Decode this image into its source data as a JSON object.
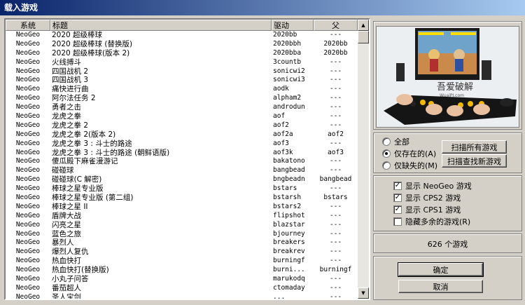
{
  "window": {
    "title": "载入游戏"
  },
  "columns": [
    "系统",
    "标题",
    "驱动",
    "父"
  ],
  "rows": [
    {
      "system": "NeoGeo",
      "title": "2020 超级棒球",
      "driver": "2020bb",
      "parent": "---"
    },
    {
      "system": "NeoGeo",
      "title": "2020 超级棒球 (替换版)",
      "driver": "2020bbh",
      "parent": "2020bb"
    },
    {
      "system": "NeoGeo",
      "title": "2020 超级棒球(版本 2)",
      "driver": "2020bba",
      "parent": "2020bb"
    },
    {
      "system": "NeoGeo",
      "title": "火线搏斗",
      "driver": "3countb",
      "parent": "---"
    },
    {
      "system": "NeoGeo",
      "title": "四国战机 2",
      "driver": "sonicwi2",
      "parent": "---"
    },
    {
      "system": "NeoGeo",
      "title": "四国战机 3",
      "driver": "sonicwi3",
      "parent": "---"
    },
    {
      "system": "NeoGeo",
      "title": "痛快进行曲",
      "driver": "aodk",
      "parent": "---"
    },
    {
      "system": "NeoGeo",
      "title": "阿尔法任务 2",
      "driver": "alpham2",
      "parent": "---"
    },
    {
      "system": "NeoGeo",
      "title": "勇者之击",
      "driver": "androdun",
      "parent": "---"
    },
    {
      "system": "NeoGeo",
      "title": "龙虎之拳",
      "driver": "aof",
      "parent": "---"
    },
    {
      "system": "NeoGeo",
      "title": "龙虎之拳 2",
      "driver": "aof2",
      "parent": "---"
    },
    {
      "system": "NeoGeo",
      "title": "龙虎之拳 2(版本 2)",
      "driver": "aof2a",
      "parent": "aof2"
    },
    {
      "system": "NeoGeo",
      "title": "龙虎之拳 3 : 斗士的路途",
      "driver": "aof3",
      "parent": "---"
    },
    {
      "system": "NeoGeo",
      "title": "龙虎之拳 3 : 斗士的路途 (朝鲜语版)",
      "driver": "aof3k",
      "parent": "aof3"
    },
    {
      "system": "NeoGeo",
      "title": "傻瓜殿下麻雀漫游记",
      "driver": "bakatono",
      "parent": "---"
    },
    {
      "system": "NeoGeo",
      "title": "碰碰球",
      "driver": "bangbead",
      "parent": "---"
    },
    {
      "system": "NeoGeo",
      "title": "碰碰球(C 解密)",
      "driver": "bngbeadn",
      "parent": "bangbead"
    },
    {
      "system": "NeoGeo",
      "title": "棒球之星专业版",
      "driver": "bstars",
      "parent": "---"
    },
    {
      "system": "NeoGeo",
      "title": "棒球之星专业版 (第二组)",
      "driver": "bstarsh",
      "parent": "bstars"
    },
    {
      "system": "NeoGeo",
      "title": "棒球之星 II",
      "driver": "bstars2",
      "parent": "---"
    },
    {
      "system": "NeoGeo",
      "title": "盾牌大战",
      "driver": "flipshot",
      "parent": "---"
    },
    {
      "system": "NeoGeo",
      "title": "闪亮之星",
      "driver": "blazstar",
      "parent": "---"
    },
    {
      "system": "NeoGeo",
      "title": "蓝色之旅",
      "driver": "bjourney",
      "parent": "---"
    },
    {
      "system": "NeoGeo",
      "title": "暴烈人",
      "driver": "breakers",
      "parent": "---"
    },
    {
      "system": "NeoGeo",
      "title": "爆烈人复仇",
      "driver": "breakrev",
      "parent": "---"
    },
    {
      "system": "NeoGeo",
      "title": "热血快打",
      "driver": "burningf",
      "parent": "---"
    },
    {
      "system": "NeoGeo",
      "title": "热血快打(替换版)",
      "driver": "burni...",
      "parent": "burningf"
    },
    {
      "system": "NeoGeo",
      "title": "小丸子问答",
      "driver": "marukodq",
      "parent": "---"
    },
    {
      "system": "NeoGeo",
      "title": "番茄超人",
      "driver": "ctomaday",
      "parent": "---"
    },
    {
      "system": "NeoGeo",
      "title": "圣人宝剑",
      "driver": "...",
      "parent": "---"
    }
  ],
  "scan": {
    "filter_options": [
      "全部",
      "仅存在的(A)",
      "仅缺失的(M)"
    ],
    "selected_filter": "仅存在的(A)",
    "scan_all_label": "扫描所有游戏",
    "scan_new_label": "扫描查找新游戏"
  },
  "options": [
    {
      "label": "显示 NeoGeo 游戏",
      "checked": true
    },
    {
      "label": "显示 CPS2 游戏",
      "checked": true
    },
    {
      "label": "显示 CPS1 游戏",
      "checked": true
    },
    {
      "label": "隐藏多余的游戏(R)",
      "checked": false
    }
  ],
  "status": {
    "game_count": "626 个游戏"
  },
  "buttons": {
    "ok": "确定",
    "cancel": "取消"
  },
  "preview": {
    "logo_text": "吾爱破解",
    "logo_sub": "WuaiPJ.com"
  }
}
